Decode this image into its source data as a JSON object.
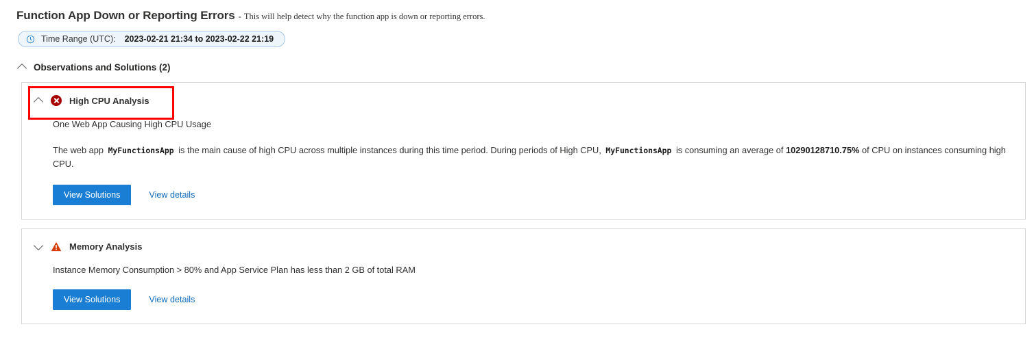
{
  "header": {
    "title": "Function App Down or Reporting Errors",
    "dash": "-",
    "subtitle": "This will help detect why the function app is down or reporting errors."
  },
  "time_range": {
    "icon": "clock-icon",
    "label": "Time Range (UTC):",
    "value": "2023-02-21 21:34 to 2023-02-22 21:19"
  },
  "section": {
    "title": "Observations and Solutions (2)",
    "expanded": true,
    "chevron": "chevron-up-icon"
  },
  "colors": {
    "primary_button": "#1a7fd4",
    "link": "#0f6cbd",
    "error": "#a80000",
    "warning": "#d83b01",
    "annotation": "#ff0000",
    "pill_background": "#eef6fc",
    "pill_border": "#a8c8e8",
    "card_border": "#d6d6d6"
  },
  "cards": [
    {
      "id": "high-cpu-analysis",
      "title": "High CPU Analysis",
      "status_icon": "error-circle-x-icon",
      "chevron": "chevron-up-icon",
      "expanded": true,
      "highlighted": true,
      "subhead": "One Web App Causing High CPU Usage",
      "paragraph": {
        "part1": "The web app",
        "app_name_1": "MyFunctionsApp",
        "part2": "is the main cause of high CPU across multiple instances during this time period. During periods of High CPU,",
        "app_name_2": "MyFunctionsApp",
        "part3": "is consuming an average of",
        "value": "10290128710.75%",
        "part4": "of CPU on instances consuming high CPU."
      },
      "actions": {
        "primary_label": "View Solutions",
        "link_label": "View details"
      }
    },
    {
      "id": "memory-analysis",
      "title": "Memory Analysis",
      "status_icon": "warning-triangle-icon",
      "chevron": "chevron-down-icon",
      "expanded": false,
      "highlighted": false,
      "subhead": "Instance Memory Consumption > 80% and App Service Plan has less than 2 GB of total RAM",
      "actions": {
        "primary_label": "View Solutions",
        "link_label": "View details"
      }
    }
  ]
}
